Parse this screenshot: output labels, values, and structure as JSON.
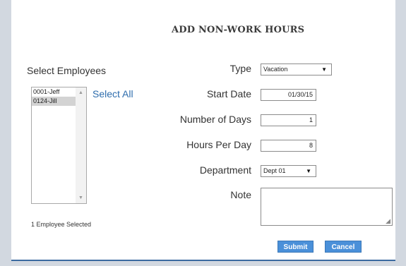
{
  "dialog": {
    "title": "ADD NON-WORK HOURS"
  },
  "employees": {
    "label": "Select Employees",
    "list": [
      {
        "text": "0001-Jeff",
        "selected": false
      },
      {
        "text": "0124-Jill",
        "selected": true
      }
    ],
    "select_all": "Select All",
    "count_text": "1  Employee Selected"
  },
  "form": {
    "type_label": "Type",
    "type_value": "Vacation",
    "start_date_label": "Start Date",
    "start_date_value": "01/30/15",
    "num_days_label": "Number of Days",
    "num_days_value": "1",
    "hours_label": "Hours Per Day",
    "hours_value": "8",
    "department_label": "Department",
    "department_value": "Dept 01",
    "note_label": "Note",
    "note_value": ""
  },
  "buttons": {
    "submit": "Submit",
    "cancel": "Cancel"
  },
  "icons": {
    "dropdown": "▼",
    "scroll_up": "▲",
    "scroll_down": "▼",
    "resize_grip": "◢"
  },
  "colors": {
    "accent": "#4a90d9",
    "link": "#2e6dad",
    "frame": "#d2d8e0"
  }
}
